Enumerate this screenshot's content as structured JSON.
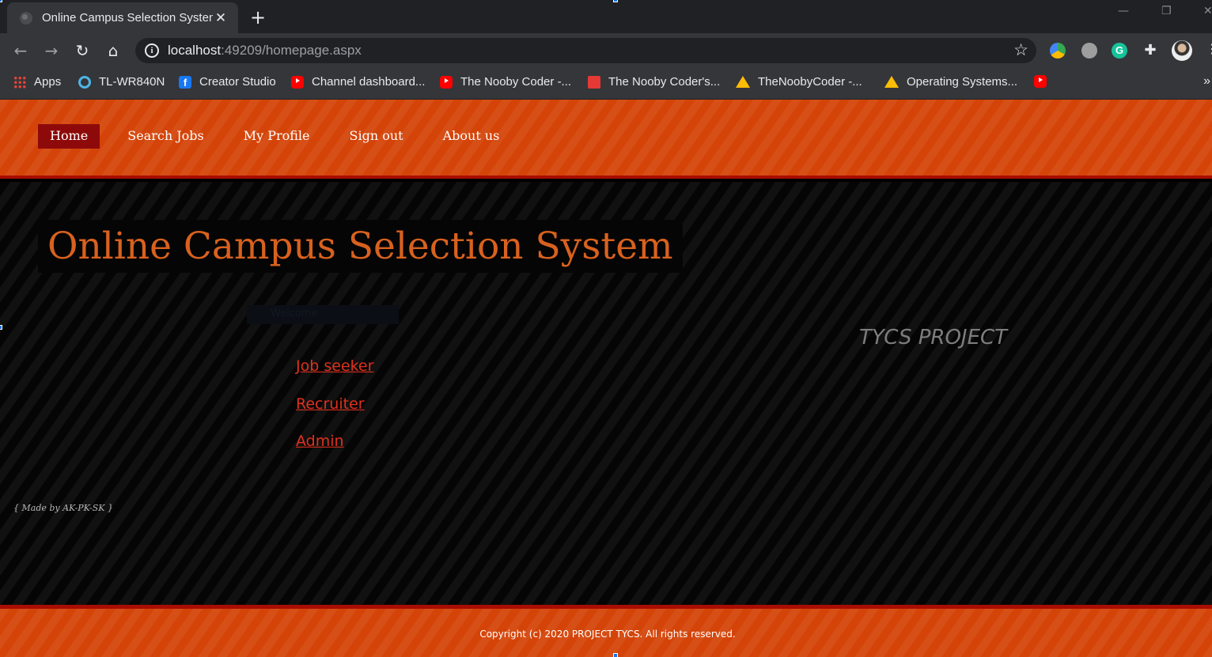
{
  "browser": {
    "tab_title": "Online Campus Selection System",
    "tab_close": "✕",
    "new_tab": "+",
    "url_host": "localhost",
    "url_path": ":49209/homepage.aspx",
    "bookmarks": [
      {
        "label": "Apps",
        "icon": "apps-grid-icon"
      },
      {
        "label": "TL-WR840N",
        "icon": "tp-link-icon"
      },
      {
        "label": "Creator Studio",
        "icon": "facebook-icon"
      },
      {
        "label": "Channel dashboard...",
        "icon": "youtube-icon"
      },
      {
        "label": "The Nooby Coder -...",
        "icon": "youtube-icon"
      },
      {
        "label": "The Nooby Coder's...",
        "icon": "analytics-icon"
      },
      {
        "label": "TheNoobyCoder -...",
        "icon": "google-drive-icon"
      },
      {
        "label": "Operating Systems...",
        "icon": "google-drive-icon"
      },
      {
        "label": "",
        "icon": "youtube-icon"
      }
    ],
    "more_bookmarks": "»"
  },
  "site": {
    "menu": [
      {
        "label": "Home",
        "active": true
      },
      {
        "label": "Search Jobs",
        "active": false
      },
      {
        "label": "My Profile",
        "active": false
      },
      {
        "label": "Sign out",
        "active": false
      },
      {
        "label": "About us",
        "active": false
      }
    ],
    "title": "Online Campus Selection System",
    "welcome": "Welcome",
    "links": [
      "Job seeker",
      "Recruiter",
      "Admin"
    ],
    "side_heading": "TYCS PROJECT",
    "made_by": "{ Made by AK-PK-SK }",
    "copyright": "Copyright (c) 2020 PROJECT TYCS. All rights reserved."
  },
  "colors": {
    "header_orange": "#d44409",
    "menu_active": "#8e0a0a",
    "title_orange": "#d8611e",
    "link_red": "#e0301d"
  }
}
